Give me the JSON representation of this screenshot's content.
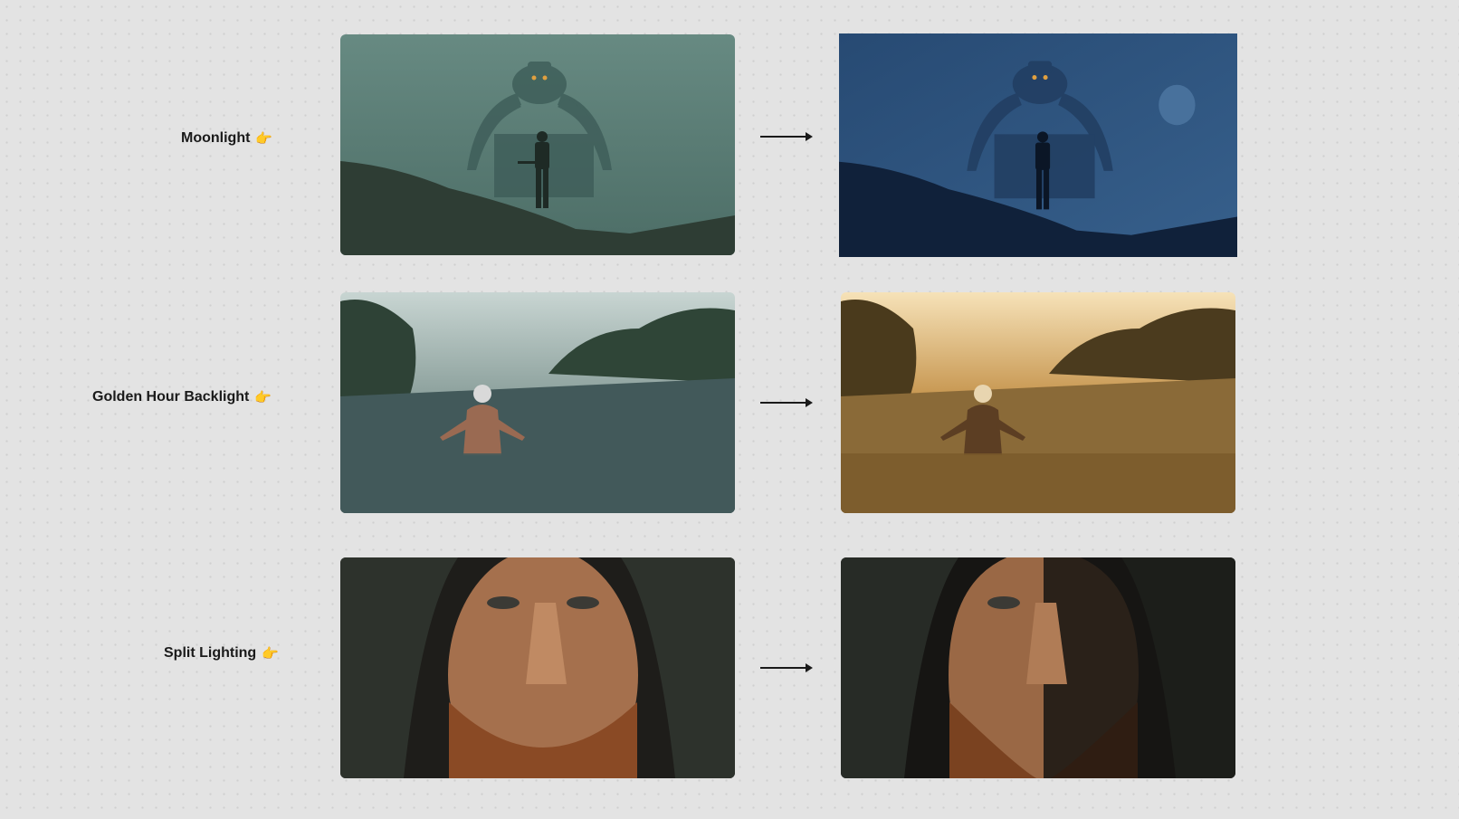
{
  "rows": [
    {
      "label": "Moonlight",
      "pointer_icon": "pointing-hand-icon"
    },
    {
      "label": "Golden Hour Backlight",
      "pointer_icon": "pointing-hand-icon"
    },
    {
      "label": "Split Lighting",
      "pointer_icon": "pointing-hand-icon"
    }
  ],
  "colors": {
    "background": "#e3e3e3",
    "moonlight_before": "#56776f",
    "moonlight_after": "#2c4a72",
    "golden_before": "#4d6460",
    "golden_after": "#c99a55",
    "split_before": "#2a2622",
    "split_after": "#1c1a18"
  }
}
